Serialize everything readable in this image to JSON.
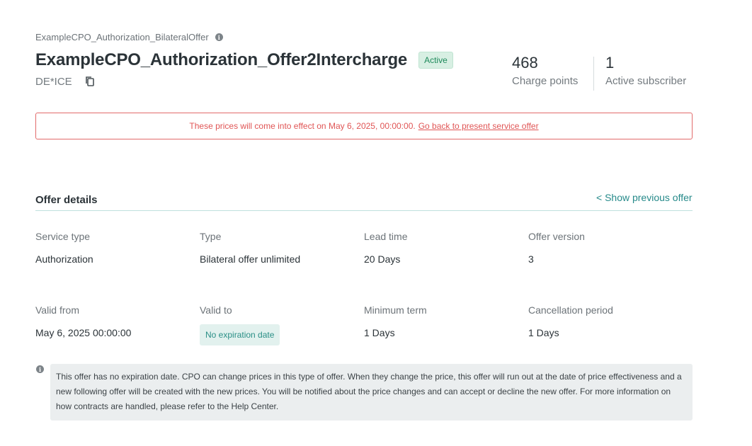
{
  "header": {
    "breadcrumb": "ExampleCPO_Authorization_BilateralOffer",
    "title": "ExampleCPO_Authorization_Offer2Intercharge",
    "status": "Active",
    "party_id": "DE*ICE"
  },
  "stats": {
    "charge_points_value": "468",
    "charge_points_label": "Charge points",
    "subscribers_value": "1",
    "subscribers_label": "Active subscriber"
  },
  "alert": {
    "text": "These prices will come into effect on May 6, 2025, 00:00:00.",
    "link": "Go back to present service offer"
  },
  "offer": {
    "section_title": "Offer details",
    "previous_link": "< Show previous offer",
    "service_type_label": "Service type",
    "service_type_value": "Authorization",
    "type_label": "Type",
    "type_value": "Bilateral offer unlimited",
    "lead_time_label": "Lead time",
    "lead_time_value": "20 Days",
    "version_label": "Offer version",
    "version_value": "3",
    "valid_from_label": "Valid from",
    "valid_from_value": "May 6, 2025 00:00:00",
    "valid_to_label": "Valid to",
    "valid_to_value": "No expiration date",
    "min_term_label": "Minimum term",
    "min_term_value": "1 Days",
    "cancel_label": "Cancellation period",
    "cancel_value": "1 Days"
  },
  "note": {
    "text": "This offer has no expiration date. CPO can change prices in this type of offer. When they change the price, this offer will run out at the date of price effectiveness and a new following offer will be created with the new prices. You will be notified about the price changes and can accept or decline the new offer. For more information on how contracts are handled, please refer to the Help Center."
  },
  "colors": {
    "accent": "#268a8a",
    "alert": "#e05555",
    "active_badge_bg": "#d8efe3"
  }
}
